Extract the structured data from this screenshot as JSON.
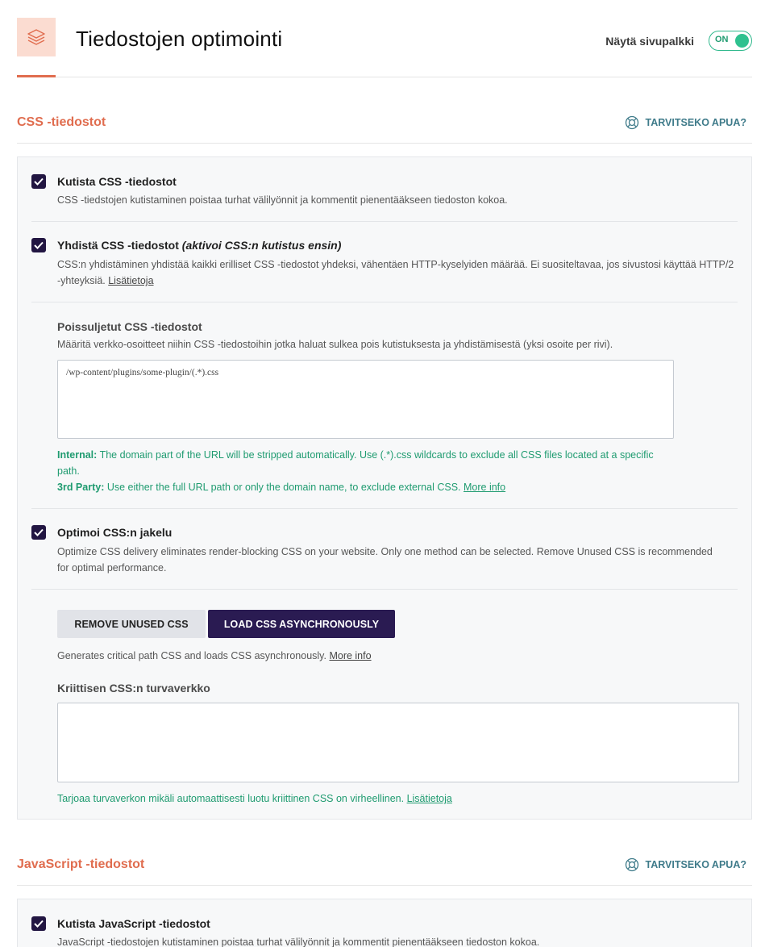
{
  "header": {
    "title": "Tiedostojen optimointi",
    "sidebar_label": "Näytä sivupalkki",
    "toggle_text": "ON",
    "icon": "layers-icon"
  },
  "css_section": {
    "title": "CSS -tiedostot",
    "help": "TARVITSEKO APUA?",
    "minify": {
      "checked": true,
      "label": "Kutista CSS -tiedostot",
      "desc": "CSS -tiedstojen kutistaminen poistaa turhat välilyönnit ja kommentit pienentääkseen tiedoston kokoa."
    },
    "combine": {
      "checked": true,
      "label": "Yhdistä CSS -tiedostot",
      "label_note": "(aktivoi CSS:n kutistus ensin)",
      "desc_line1": "CSS:n yhdistäminen yhdistää kaikki erilliset CSS -tiedostot yhdeksi, vähentäen HTTP-kyselyiden määrää. Ei suositeltavaa, jos sivustosi käyttää HTTP/2",
      "desc_line2": "-yhteyksiä.",
      "link": "Lisätietoja"
    },
    "excluded": {
      "title": "Poissuljetut CSS -tiedostot",
      "desc": "Määritä verkko-osoitteet niihin CSS -tiedostoihin jotka haluat sulkea pois kutistuksesta ja yhdistämisestä (yksi osoite per rivi).",
      "value": "/wp-content/plugins/some-plugin/(.*).css",
      "internal_label": "Internal:",
      "internal_line1": "The domain part of the URL will be stripped automatically. Use (.*).css wildcards to exclude all CSS files located at a specific",
      "internal_line2": "path.",
      "third_label": "3rd Party:",
      "third_text": "Use either the full URL path or only the domain name, to exclude external CSS.",
      "third_link": "More info"
    },
    "delivery": {
      "checked": true,
      "label": "Optimoi CSS:n jakelu",
      "desc_line1": "Optimize CSS delivery eliminates render-blocking CSS on your website. Only one method can be selected. Remove Unused CSS is recommended",
      "desc_line2": "for optimal performance.",
      "btn_remove": "REMOVE UNUSED CSS",
      "btn_async": "LOAD CSS ASYNCHRONOUSLY",
      "method_desc": "Generates critical path CSS and loads CSS asynchronously.",
      "method_link": "More info",
      "safety_title": "Kriittisen CSS:n turvaverkko",
      "safety_value": "",
      "safety_note": "Tarjoaa turvaverkon mikäli automaattisesti luotu kriittinen CSS on virheellinen.",
      "safety_link": "Lisätietoja"
    }
  },
  "js_section": {
    "title": "JavaScript -tiedostot",
    "help": "TARVITSEKO APUA?",
    "minify": {
      "checked": true,
      "label": "Kutista JavaScript -tiedostot",
      "desc": "JavaScript -tiedostojen kutistaminen poistaa turhat välilyönnit ja kommentit pienentääkseen tiedoston kokoa."
    }
  },
  "colors": {
    "accent": "#e06d4f",
    "green": "#1f9b70",
    "dark": "#2a1b52"
  }
}
